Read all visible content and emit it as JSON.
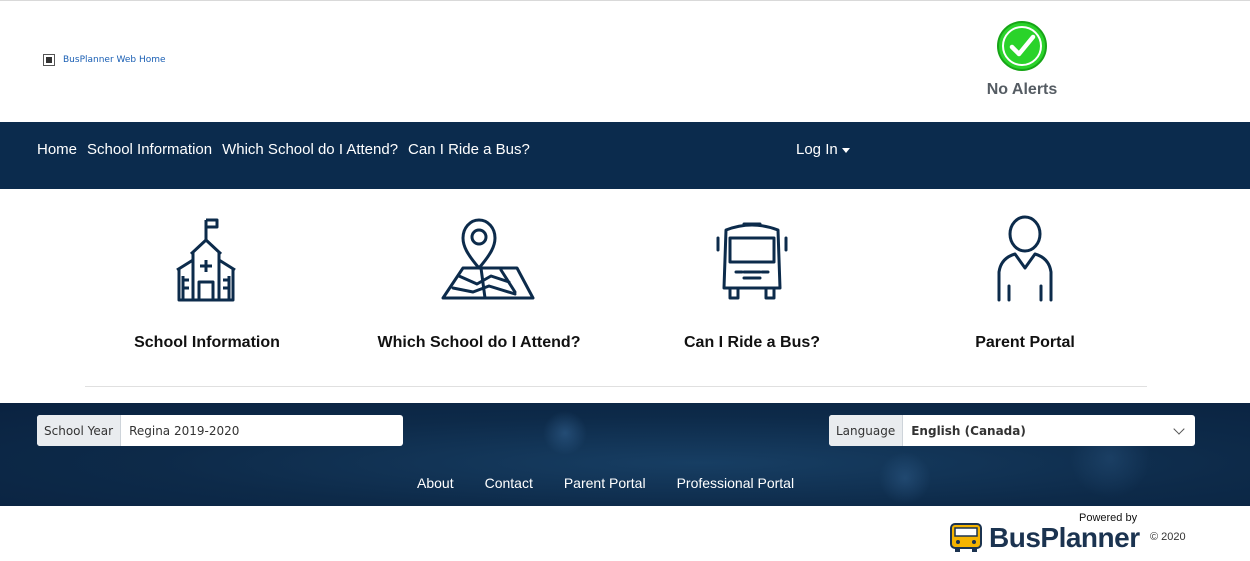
{
  "header": {
    "logo_alt": "BusPlanner Web Home",
    "alert_status": "No Alerts",
    "alert_color": "#2ad32a"
  },
  "nav": {
    "items": [
      {
        "label": "Home"
      },
      {
        "label": "School Information"
      },
      {
        "label": "Which School do I Attend?"
      },
      {
        "label": "Can I Ride a Bus?"
      }
    ],
    "login_label": "Log In",
    "background": "#0b2b4d"
  },
  "tiles": [
    {
      "label": "School Information",
      "icon": "school-icon"
    },
    {
      "label": "Which School do I Attend?",
      "icon": "map-pin-icon"
    },
    {
      "label": "Can I Ride a Bus?",
      "icon": "bus-icon"
    },
    {
      "label": "Parent Portal",
      "icon": "person-icon"
    }
  ],
  "footer": {
    "school_year_label": "School Year",
    "school_year_value": "Regina 2019-2020",
    "language_label": "Language",
    "language_value": "English (Canada)",
    "links": [
      {
        "label": "About"
      },
      {
        "label": "Contact"
      },
      {
        "label": "Parent Portal"
      },
      {
        "label": "Professional Portal"
      }
    ]
  },
  "powered": {
    "powered_by": "Powered by",
    "brand": "BusPlanner",
    "copyright": "© 2020"
  }
}
